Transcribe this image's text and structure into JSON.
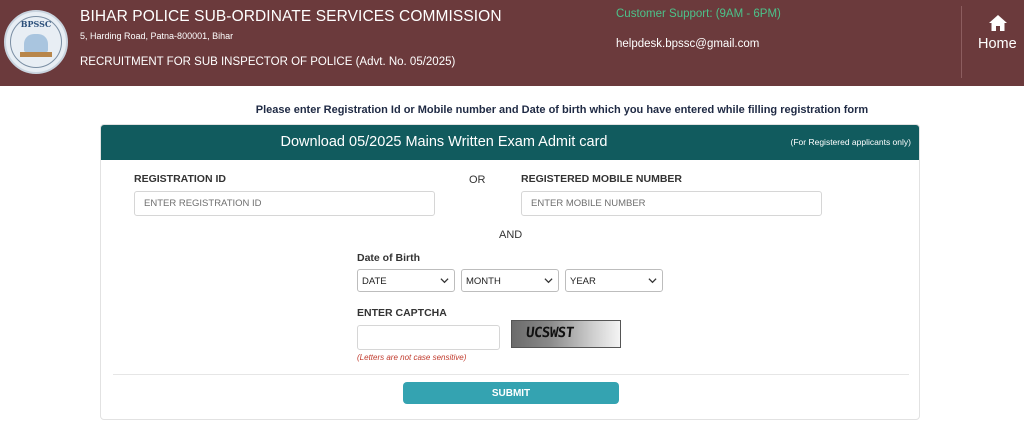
{
  "header": {
    "logo_text": "BPSSC",
    "org_title": "BIHAR POLICE SUB-ORDINATE SERVICES COMMISSION",
    "address": "5, Harding Road, Patna-800001, Bihar",
    "recruitment": "RECRUITMENT FOR SUB INSPECTOR OF POLICE (Advt. No. 05/2025)",
    "support_hours": "Customer Support: (9AM - 6PM)",
    "support_email": "helpdesk.bpssc@gmail.com",
    "home_label": "Home"
  },
  "instruction": "Please enter Registration Id or Mobile number and Date of birth which you have entered while filling registration form",
  "card": {
    "title": "Download 05/2025 Mains Written Exam Admit card",
    "note": "(For Registered applicants only)"
  },
  "form": {
    "registration_label": "REGISTRATION ID",
    "registration_placeholder": "ENTER REGISTRATION ID",
    "registration_value": "",
    "or_text": "OR",
    "mobile_label": "REGISTERED MOBILE NUMBER",
    "mobile_placeholder": "ENTER MOBILE NUMBER",
    "mobile_value": "",
    "and_text": "AND",
    "dob_label": "Date of Birth",
    "date_selected": "DATE",
    "month_selected": "MONTH",
    "year_selected": "YEAR",
    "captcha_label": "ENTER CAPTCHA",
    "captcha_value": "",
    "captcha_image_text": "UCSWST",
    "captcha_hint": "(Letters are not case sensitive)",
    "submit_label": "SUBMIT"
  },
  "colors": {
    "header_bg": "#6b3a3c",
    "support_text": "#4cc28a",
    "card_header_bg": "#115b5e",
    "submit_bg": "#34a3b1",
    "hint_text": "#c0392b"
  },
  "icons": {
    "home": "home-icon",
    "dropdown": "chevron-down-icon"
  }
}
